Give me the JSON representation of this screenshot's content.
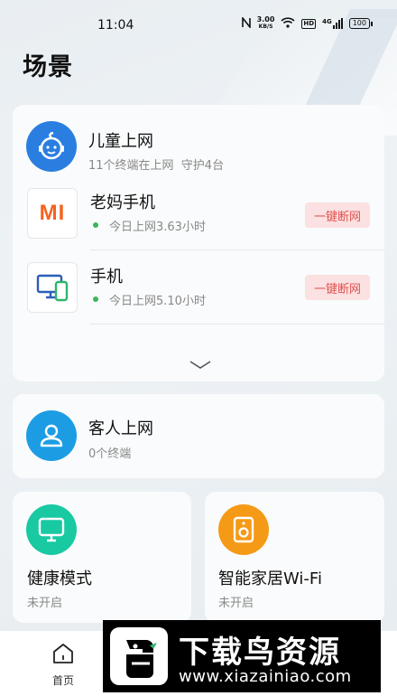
{
  "status_bar": {
    "time": "11:04",
    "net_speed_value": "3.00",
    "net_speed_unit": "KB/S",
    "hd_label": "HD",
    "signal_label": "4G",
    "battery": "100"
  },
  "page_title": "场景",
  "kids": {
    "title": "儿童上网",
    "subtitle": "11个终端在上网  守护4台",
    "devices": [
      {
        "name": "老妈手机",
        "usage": "今日上网3.63小时",
        "action": "一键断网",
        "logo_text": "MI"
      },
      {
        "name": "手机",
        "usage": "今日上网5.10小时",
        "action": "一键断网"
      }
    ]
  },
  "guest": {
    "title": "客人上网",
    "subtitle": "0个终端"
  },
  "health": {
    "title": "健康模式",
    "status": "未开启"
  },
  "smart_home": {
    "title": "智能家居Wi-Fi",
    "status": "未开启"
  },
  "bottom_nav": {
    "home_label": "首页"
  },
  "watermark": {
    "title": "下载鸟资源",
    "url": "www.xiazainiao.com"
  },
  "colors": {
    "kids_icon": "#2a7ee0",
    "guest_icon": "#1c9de3",
    "health_icon": "#18c9a2",
    "smart_icon": "#f59a17",
    "mi_orange": "#f5631f",
    "cut_bg": "#fbe1e1",
    "cut_text": "#e0524f",
    "online_dot": "#3cb55b"
  }
}
